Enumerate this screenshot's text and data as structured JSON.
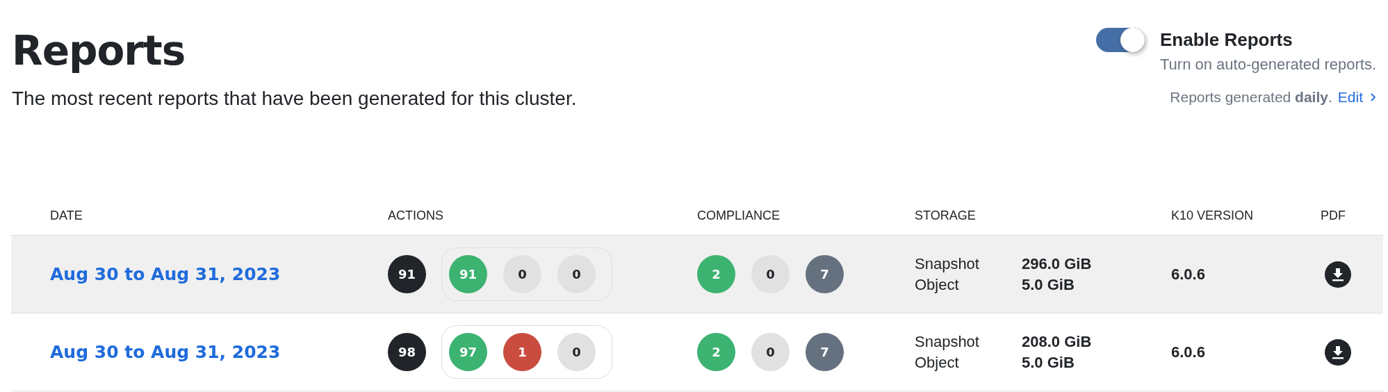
{
  "header": {
    "title": "Reports",
    "subtitle": "The most recent reports that have been generated for this cluster."
  },
  "enable_reports": {
    "on": true,
    "label": "Enable Reports",
    "description": "Turn on auto-generated reports.",
    "schedule": "Reports generated **daily**.",
    "edit_link": "Edit"
  },
  "table": {
    "columns": [
      "DATE",
      "ACTIONS",
      "COMPLIANCE",
      "STORAGE",
      "K10 VERSION",
      "PDF"
    ],
    "rows": [
      {
        "selected": true,
        "date": "Aug 30 to Aug 31, 2023",
        "actions_total": {
          "value": "91",
          "color": "#212428"
        },
        "actions": [
          {
            "value": "91",
            "color": "#3cb371"
          },
          {
            "value": "0",
            "color": "#e1e1e1"
          },
          {
            "value": "0",
            "color": "#e1e1e1"
          }
        ],
        "compliance": [
          {
            "value": "2",
            "color": "#3cb371"
          },
          {
            "value": "0",
            "color": "#e1e1e1"
          },
          {
            "value": "7",
            "color": "#65717f"
          }
        ],
        "storage": [
          {
            "label": "Snapshot",
            "value": "296.0 GiB"
          },
          {
            "label": "Object",
            "value": "5.0 GiB"
          }
        ],
        "version": "6.0.6"
      },
      {
        "selected": false,
        "date": "Aug 30 to Aug 31, 2023",
        "actions_total": {
          "value": "98",
          "color": "#212428"
        },
        "actions": [
          {
            "value": "97",
            "color": "#3cb371"
          },
          {
            "value": "1",
            "color": "#c94c3f"
          },
          {
            "value": "0",
            "color": "#e1e1e1"
          }
        ],
        "compliance": [
          {
            "value": "2",
            "color": "#3cb371"
          },
          {
            "value": "0",
            "color": "#e1e1e1"
          },
          {
            "value": "7",
            "color": "#65717f"
          }
        ],
        "storage": [
          {
            "label": "Snapshot",
            "value": "208.0 GiB"
          },
          {
            "label": "Object",
            "value": "5.0 GiB"
          }
        ],
        "version": "6.0.6"
      }
    ]
  }
}
